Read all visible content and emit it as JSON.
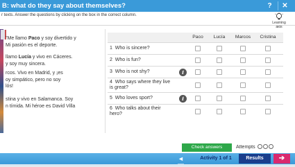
{
  "window": {
    "title": "B: what do they say about themselves?",
    "help_label": "?",
    "close_label": "✕"
  },
  "instructions": "r texts. Answer the questions by clicking on the box in the correct column.",
  "learning_aids": {
    "label_line1": "Learning",
    "label_line2": "aids"
  },
  "texts": {
    "p1": {
      "prefix": "\"Me llamo ",
      "name": "Paco",
      "rest": " y soy divertido y",
      "line2": "Mi pasión es el deporte."
    },
    "p2": {
      "prefix": "llamo ",
      "name": "Lucía",
      "rest": " y vivo en Cáceres.",
      "line2": "y soy muy sincera."
    },
    "p3": {
      "line1": "rcos. Vivo en Madrid, y ¡es",
      "line2": "oy simpático, pero no soy",
      "line3": "lós!"
    },
    "p4": {
      "line1": "stina y vivo en Salamanca. Soy",
      "line2": "n tímida. Mi héroe es David Villa"
    }
  },
  "table": {
    "columns": [
      "Paco",
      "Lucía",
      "Marcos",
      "Cristina"
    ],
    "questions": [
      {
        "number": "1",
        "line1": "Who is sincere?",
        "line2": "",
        "info": false
      },
      {
        "number": "2",
        "line1": "Who is fun?",
        "line2": "",
        "info": false
      },
      {
        "number": "3",
        "line1": "Who is not shy?",
        "line2": "",
        "info": true
      },
      {
        "number": "4",
        "line1": "Who says where they live",
        "line2": "is great?",
        "info": false
      },
      {
        "number": "5",
        "line1": "Who loves sport?",
        "line2": "",
        "info": true
      },
      {
        "number": "6",
        "line1": "Who talks about their",
        "line2": "hero?",
        "info": false
      }
    ],
    "info_label": "i"
  },
  "footer": {
    "check_label": "Check answers",
    "attempts_label": "Attempts",
    "attempts_total": 3,
    "activity_label": "Activity 1 of 1",
    "results_label": "Results",
    "next_label": "➔",
    "back_label": "◄—"
  },
  "colors": {
    "accent_blue": "#3a9ad9",
    "check_green": "#2ea84a",
    "results_navy": "#1a3e8c",
    "next_pink": "#d9296e"
  }
}
